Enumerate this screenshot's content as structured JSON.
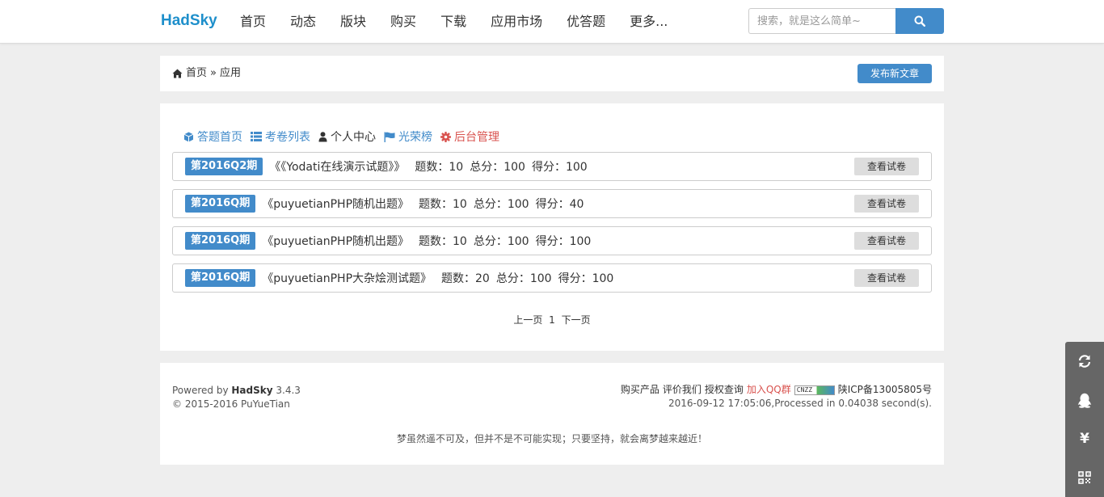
{
  "navbar": {
    "brand": "HadSky",
    "items": [
      {
        "label": "首页"
      },
      {
        "label": "动态"
      },
      {
        "label": "版块"
      },
      {
        "label": "购买"
      },
      {
        "label": "下载"
      },
      {
        "label": "应用市场"
      },
      {
        "label": "优答题"
      },
      {
        "label": "更多..."
      }
    ],
    "search": {
      "placeholder": "搜索，就是这么简单~",
      "value": ""
    }
  },
  "breadcrumb": {
    "home": "首页",
    "sep": "»",
    "current": "应用",
    "publish_label": "发布新文章"
  },
  "quick_links": [
    {
      "label": "答题首页",
      "icon": "cube-icon"
    },
    {
      "label": "考卷列表",
      "icon": "list-icon"
    },
    {
      "label": "个人中心",
      "icon": "user-icon"
    },
    {
      "label": "光荣榜",
      "icon": "flag-icon"
    },
    {
      "label": "后台管理",
      "icon": "gear-icon"
    }
  ],
  "exams": [
    {
      "period": "第2016Q2期",
      "title": "《《Yodati在线演示试题》》",
      "questions": "题数：10",
      "total": "总分：100",
      "score": "得分：100",
      "view_label": "查看试卷"
    },
    {
      "period": "第2016Q期",
      "title": "《puyuetianPHP随机出题》",
      "questions": "题数：10",
      "total": "总分：100",
      "score": "得分：40",
      "view_label": "查看试卷"
    },
    {
      "period": "第2016Q期",
      "title": "《puyuetianPHP随机出题》",
      "questions": "题数：10",
      "total": "总分：100",
      "score": "得分：100",
      "view_label": "查看试卷"
    },
    {
      "period": "第2016Q期",
      "title": "《puyuetianPHP大杂烩测试题》",
      "questions": "题数：20",
      "total": "总分：100",
      "score": "得分：100",
      "view_label": "查看试卷"
    }
  ],
  "pagination": {
    "prev": "上一页",
    "current": "1",
    "next": "下一页"
  },
  "footer": {
    "powered_prefix": "Powered by",
    "powered_name": "HadSky",
    "version": "3.4.3",
    "copyright": "© 2015-2016 PuYueTian",
    "links": [
      "购买产品",
      "评价我们",
      "授权查询"
    ],
    "qq_group": "加入QQ群",
    "badge": "CNZZ",
    "icp": "陕ICP备13005805号",
    "processed": "2016-09-12 17:05:06,Processed in 0.04038 second(s).",
    "motto": "梦虽然遥不可及，但并不是不可能实现；只要坚持，就会离梦越来越近！"
  },
  "side_tools": [
    {
      "icon": "refresh-icon"
    },
    {
      "icon": "qq-icon"
    },
    {
      "icon": "yen-icon",
      "glyph": "¥"
    },
    {
      "icon": "qrcode-icon"
    }
  ],
  "colors": {
    "brand": "#1e8fcb",
    "primary": "#428bca",
    "danger": "#d9534f"
  }
}
